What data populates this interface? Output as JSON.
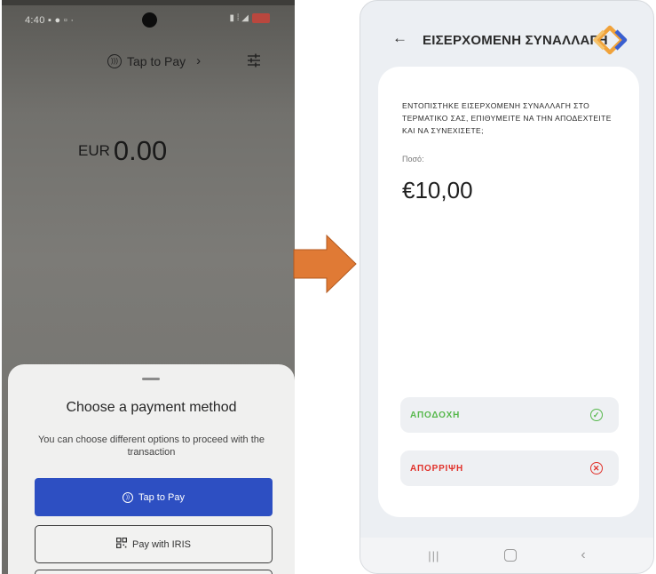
{
  "left_phone": {
    "status_time": "4:40",
    "tap_to_pay_link": "Tap to Pay",
    "currency": "EUR",
    "amount": "0.00",
    "sheet": {
      "title": "Choose a payment method",
      "subtitle": "You can choose different options to proceed with the transaction",
      "tap_to_pay_button": "Tap to Pay",
      "iris_button": "Pay with IRIS"
    }
  },
  "right_phone": {
    "header_title": "ΕΙΣΕΡΧΟΜΕΝΗ ΣΥΝΑΛΛΑΓΗ",
    "message": "ΕΝΤΟΠΙΣΤΗΚΕ ΕΙΣΕΡΧΟΜΕΝΗ ΣΥΝΑΛΛΑΓΗ ΣΤΟ ΤΕΡΜΑΤΙΚΟ ΣΑΣ, ΕΠΙΘΥΜΕΙΤΕ ΝΑ ΤΗΝ ΑΠΟΔΕΧΤΕΙΤΕ ΚΑΙ ΝΑ ΣΥΝΕΧΙΣΕΤΕ;",
    "amount_label": "Ποσό:",
    "amount_value": "€10,00",
    "accept_button": "ΑΠΟΔΟΧΗ",
    "reject_button": "ΑΠΟΡΡΙΨΗ"
  },
  "colors": {
    "primary_blue": "#2d4fc2",
    "arrow_orange": "#e07a35",
    "accept_green": "#57b84c",
    "reject_red": "#e1312a",
    "logo_orange": "#f0a23a",
    "logo_blue": "#3a5fd0"
  },
  "icons": {
    "settings": "sliders-icon",
    "back": "arrow-left-icon",
    "accept": "check-circle-icon",
    "reject": "x-circle-icon",
    "transition": "arrow-right-icon"
  }
}
